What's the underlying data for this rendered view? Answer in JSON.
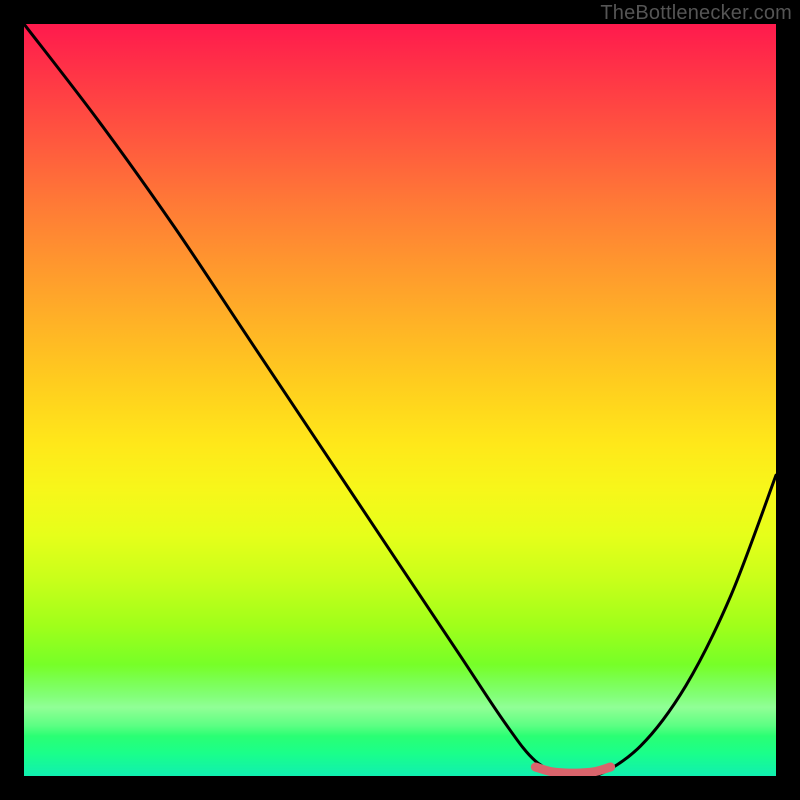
{
  "watermark": "TheBottlenecker.com",
  "chart_data": {
    "type": "line",
    "title": "",
    "xlabel": "",
    "ylabel": "",
    "xlim": [
      0,
      100
    ],
    "ylim": [
      0,
      100
    ],
    "grid": false,
    "legend": false,
    "series": [
      {
        "name": "bottleneck-curve",
        "x": [
          0,
          10,
          20,
          30,
          40,
          50,
          58,
          64,
          68,
          72,
          76,
          82,
          88,
          94,
          100
        ],
        "values": [
          100,
          87,
          73,
          58,
          43,
          28,
          16,
          7,
          2,
          0,
          0,
          4,
          12,
          24,
          40
        ]
      },
      {
        "name": "optimal-range-marker",
        "x": [
          68,
          70,
          72,
          74,
          76,
          78
        ],
        "values": [
          1.2,
          0.6,
          0.4,
          0.4,
          0.6,
          1.2
        ]
      }
    ],
    "colors": {
      "curve": "#000000",
      "marker": "#d9646c",
      "gradient_top": "#ff1a4d",
      "gradient_bottom": "#10efb0"
    }
  }
}
